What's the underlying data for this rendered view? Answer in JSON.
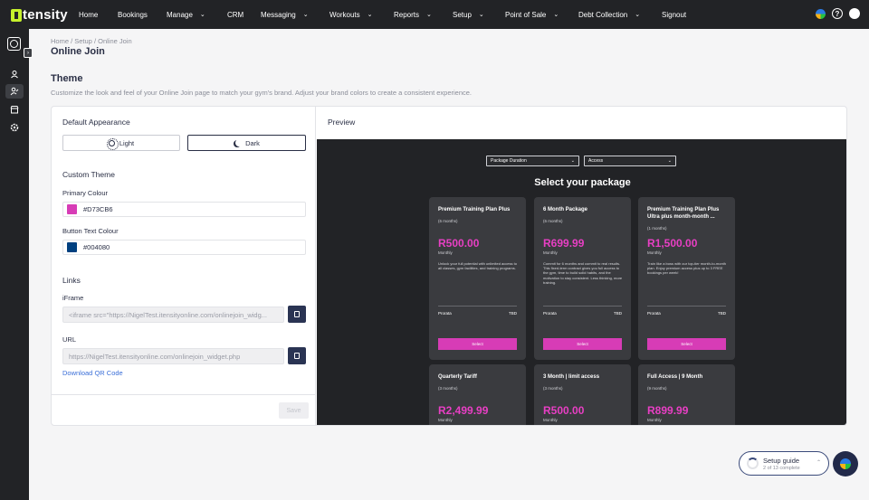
{
  "app": {
    "logo_text": "tensity"
  },
  "nav": [
    {
      "label": "Home",
      "dropdown": false
    },
    {
      "label": "Bookings",
      "dropdown": false
    },
    {
      "label": "Manage",
      "dropdown": true
    },
    {
      "label": "CRM",
      "dropdown": false
    },
    {
      "label": "Messaging",
      "dropdown": true
    },
    {
      "label": "Workouts",
      "dropdown": true
    },
    {
      "label": "Reports",
      "dropdown": true
    },
    {
      "label": "Setup",
      "dropdown": true
    },
    {
      "label": "Point of Sale",
      "dropdown": true
    },
    {
      "label": "Debt Collection",
      "dropdown": true
    },
    {
      "label": "Signout",
      "dropdown": false
    }
  ],
  "breadcrumb": "Home / Setup / Online Join",
  "page_title": "Online Join",
  "theme": {
    "title": "Theme",
    "description": "Customize the look and feel of your Online Join page to match your gym's brand. Adjust your brand colors to create a consistent experience."
  },
  "settings": {
    "default_appearance_label": "Default Appearance",
    "light_label": "Light",
    "dark_label": "Dark",
    "selected_appearance": "Dark",
    "custom_theme_label": "Custom Theme",
    "primary_colour_label": "Primary Colour",
    "primary_colour_value": "#D73CB6",
    "button_text_colour_label": "Button Text Colour",
    "button_text_colour_value": "#004080",
    "links_label": "Links",
    "iframe_label": "iFrame",
    "iframe_value": "<iframe src=\"https://NigelTest.itensityonline.com/onlinejoin_widg...",
    "url_label": "URL",
    "url_value": "https://NigelTest.itensityonline.com/onlinejoin_widget.php",
    "download_qr_label": "Download QR Code",
    "save_label": "Save"
  },
  "preview": {
    "title": "Preview",
    "select_duration": "Package Duration",
    "select_access": "Access",
    "heading": "Select your package",
    "packages": [
      {
        "name": "Premium Training Plan Plus",
        "duration": "(6 months)",
        "price": "R500.00",
        "period": "Monthly",
        "desc": "Unlock your full potential with unlimited access to all classes, gym facilities, and training programs.",
        "prorata": "Prorata",
        "prorata_value": "TBD",
        "button": "Select"
      },
      {
        "name": "6 Month Package",
        "duration": "(6 months)",
        "price": "R699.99",
        "period": "Monthly",
        "desc": "Commit for 6 months and commit to real results. This fixed-term contract gives you full access to the gym, time to build solid habits, and the motivation to stay consistent. Less thinking, more training.",
        "prorata": "Prorata",
        "prorata_value": "TBD",
        "button": "Select"
      },
      {
        "name": "Premium Training Plan Plus Ultra plus month-month ...",
        "duration": "(1 months)",
        "price": "R1,500.00",
        "period": "Monthly",
        "desc": "Train like a boss with our top-tier month-to-month plan. Enjoy premium access plus up to 3 FREE bookings per week!",
        "prorata": "Prorata",
        "prorata_value": "TBD",
        "button": "Select"
      },
      {
        "name": "Quarterly Tariff",
        "duration": "(3 months)",
        "price": "R2,499.99",
        "period": "Monthly"
      },
      {
        "name": "3 Month | limit access",
        "duration": "(3 months)",
        "price": "R500.00",
        "period": "Monthly"
      },
      {
        "name": "Full Access | 9 Month",
        "duration": "(9 months)",
        "price": "R899.99",
        "period": "Monthly"
      }
    ]
  },
  "setup_guide": {
    "title": "Setup guide",
    "progress": "2 of 13 complete"
  },
  "colors": {
    "nav_bg": "#222326",
    "primary": "#D73CB6",
    "button_text": "#004080",
    "accent_dark": "#2A3453"
  },
  "icons": [
    "home-icon",
    "help-icon",
    "avatar-icon",
    "brand-icon"
  ]
}
